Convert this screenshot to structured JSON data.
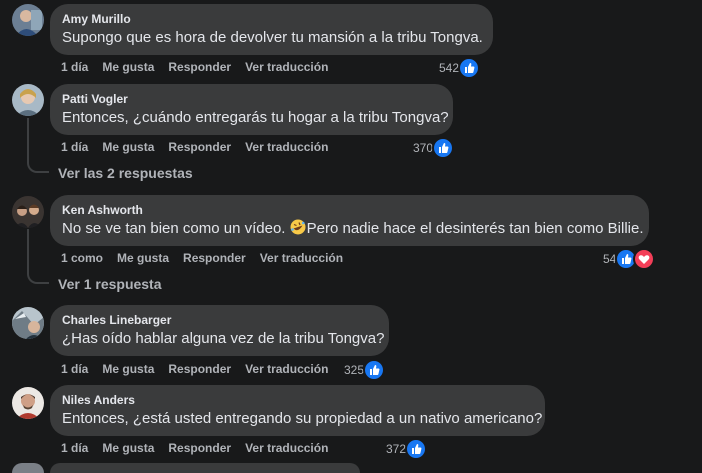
{
  "comments": [
    {
      "author": "Amy Murillo",
      "text": "Supongo que es hora de devolver tu mansión a la tribu Tongva.",
      "time": "1 día",
      "like": "Me gusta",
      "reply": "Responder",
      "translate": "Ver traducción",
      "reaction_count": "542",
      "reaction_icons": [
        "like-icon"
      ]
    },
    {
      "author": "Patti Vogler",
      "text": "Entonces, ¿cuándo entregarás tu hogar a la tribu Tongva?",
      "time": "1 día",
      "like": "Me gusta",
      "reply": "Responder",
      "translate": "Ver traducción",
      "reaction_count": "370",
      "reaction_icons": [
        "like-icon"
      ],
      "view_replies": "Ver las 2 respuestas"
    },
    {
      "author": "Ken Ashworth",
      "text_before": "No se ve tan bien como un vídeo. ",
      "emoji": "rofl-emoji",
      "text_after": "Pero nadie hace el desinterés tan bien como Billie.",
      "time": "1 como",
      "like": "Me gusta",
      "reply": "Responder",
      "translate": "Ver traducción",
      "reaction_count": "54",
      "reaction_icons": [
        "like-icon",
        "love-icon"
      ],
      "view_replies": "Ver 1 respuesta"
    },
    {
      "author": "Charles Linebarger",
      "text": "¿Has oído hablar alguna vez de la tribu Tongva?",
      "time": "1 día",
      "like": "Me gusta",
      "reply": "Responder",
      "translate": "Ver traducción",
      "reaction_count": "325",
      "reaction_icons": [
        "like-icon"
      ]
    },
    {
      "author": "Niles Anders",
      "text": "Entonces, ¿está usted entregando su propiedad a un nativo americano?",
      "time": "1 día",
      "like": "Me gusta",
      "reply": "Responder",
      "translate": "Ver traducción",
      "reaction_count": "372",
      "reaction_icons": [
        "like-icon"
      ]
    }
  ],
  "colors": {
    "background": "#18191a",
    "bubble": "#3a3b3c",
    "text": "#e4e6eb",
    "secondary": "#b0b3b8",
    "like_blue": "#1877f2",
    "love_red": "#f33e58"
  }
}
